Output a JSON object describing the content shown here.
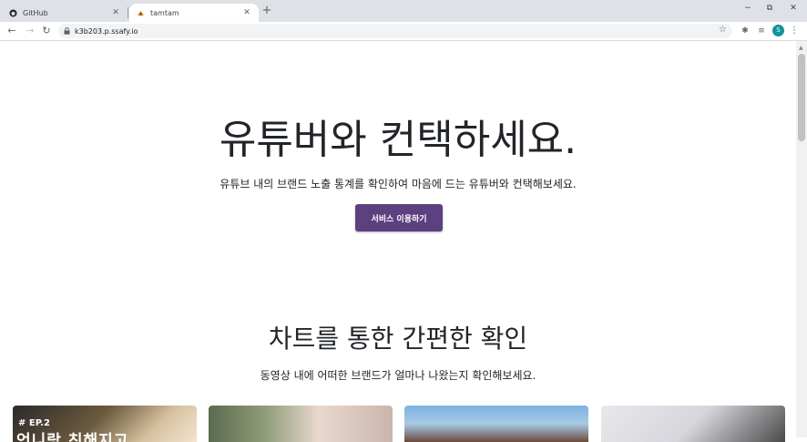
{
  "browser": {
    "tabs": [
      {
        "title": "GitHub",
        "icon": "github-icon",
        "active": false
      },
      {
        "title": "tamtam",
        "icon": "tamtam-favicon",
        "active": true
      }
    ],
    "new_tab_symbol": "+",
    "url": "k3b203.p.ssafy.io",
    "profile_initial": "S",
    "window_controls": {
      "minimize": "−",
      "restore": "⧉",
      "close": "✕"
    }
  },
  "hero": {
    "title": "유튜버와 컨택하세요.",
    "subtitle": "유튜브 내의 브랜드 노출 통계를 확인하여 마음에 드는 유튜버와 컨택해보세요.",
    "cta_label": "서비스 이용하기",
    "cta_color": "#5c4080"
  },
  "chart_section": {
    "title": "차트를 통한 간편한 확인",
    "subtitle": "동영상 내에 어떠한 브랜드가 얼마나 나왔는지 확인해보세요."
  },
  "cards": [
    {
      "badge": "# EP.2",
      "caption": "언니랑 친해지고"
    },
    {
      "badge": "",
      "caption": ""
    },
    {
      "badge": "",
      "caption": ""
    },
    {
      "badge": "",
      "caption": ""
    }
  ]
}
